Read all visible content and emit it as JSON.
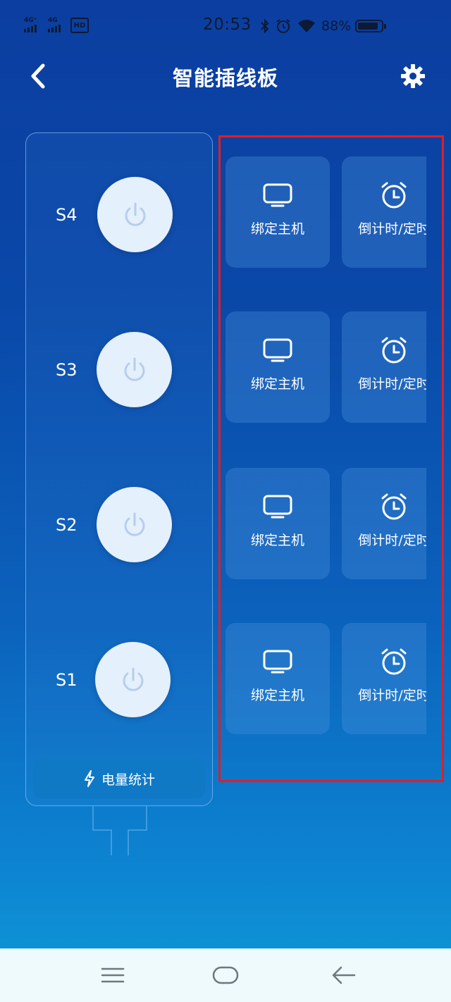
{
  "status_bar": {
    "net1": "4G⁺",
    "net2": "4G",
    "hd": "HD",
    "time": "20:53",
    "battery_percent": "88%",
    "battery_level": 0.88,
    "icons": [
      "bluetooth-icon",
      "alarm-icon",
      "wifi-icon",
      "battery-icon"
    ]
  },
  "header": {
    "title": "智能插线板",
    "back_icon": "chevron-left-icon",
    "settings_icon": "gear-icon"
  },
  "power_strip": {
    "sockets": [
      {
        "label": "S4",
        "icon": "power-icon"
      },
      {
        "label": "S3",
        "icon": "power-icon"
      },
      {
        "label": "S2",
        "icon": "power-icon"
      },
      {
        "label": "S1",
        "icon": "power-icon"
      }
    ],
    "stats_button": {
      "label": "电量统计",
      "icon": "lightning-icon"
    }
  },
  "socket_actions": [
    {
      "bind_label": "绑定主机",
      "timer_label": "倒计时/定时"
    },
    {
      "bind_label": "绑定主机",
      "timer_label": "倒计时/定时"
    },
    {
      "bind_label": "绑定主机",
      "timer_label": "倒计时/定时"
    },
    {
      "bind_label": "绑定主机",
      "timer_label": "倒计时/定时"
    }
  ],
  "colors": {
    "highlight": "#e51c23",
    "background_top": "#0b3ea0",
    "background_bottom": "#109ad8"
  },
  "nav_bar": {
    "icons": [
      "menu-icon",
      "home-icon",
      "back-arrow-icon"
    ]
  }
}
